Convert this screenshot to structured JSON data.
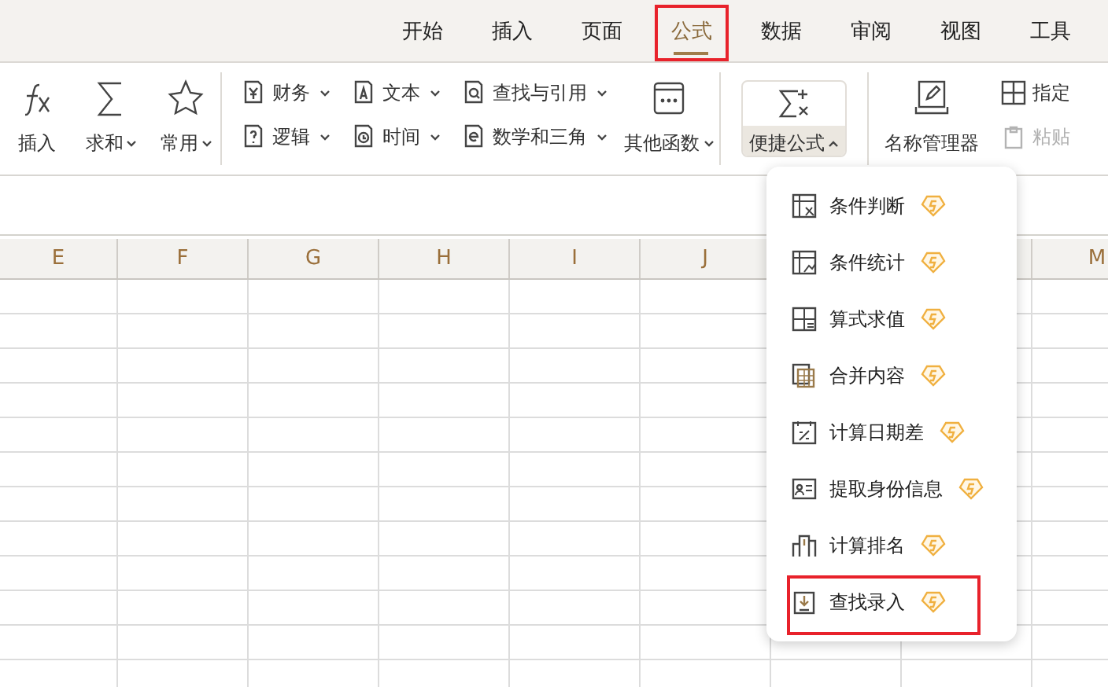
{
  "tabs": [
    {
      "label": "开始",
      "selected": false,
      "highlighted": false
    },
    {
      "label": "插入",
      "selected": false,
      "highlighted": false
    },
    {
      "label": "页面",
      "selected": false,
      "highlighted": false
    },
    {
      "label": "公式",
      "selected": true,
      "highlighted": true
    },
    {
      "label": "数据",
      "selected": false,
      "highlighted": false
    },
    {
      "label": "审阅",
      "selected": false,
      "highlighted": false
    },
    {
      "label": "视图",
      "selected": false,
      "highlighted": false
    },
    {
      "label": "工具",
      "selected": false,
      "highlighted": false
    }
  ],
  "ribbon": {
    "large_buttons": [
      {
        "label": "插入",
        "dropdown": false
      },
      {
        "label": "求和",
        "dropdown": true
      },
      {
        "label": "常用",
        "dropdown": true
      }
    ],
    "function_categories": [
      {
        "label": "财务"
      },
      {
        "label": "文本"
      },
      {
        "label": "查找与引用"
      },
      {
        "label": "逻辑"
      },
      {
        "label": "时间"
      },
      {
        "label": "数学和三角"
      }
    ],
    "other_functions": {
      "label": "其他函数"
    },
    "quick_formula": {
      "label": "便捷公式",
      "expanded": true
    },
    "name_manager": {
      "label": "名称管理器"
    },
    "small_buttons": [
      {
        "label": "指定",
        "disabled": false
      },
      {
        "label": "粘贴",
        "disabled": true
      }
    ]
  },
  "sheet": {
    "columns": [
      "E",
      "F",
      "G",
      "H",
      "I",
      "J",
      "M"
    ]
  },
  "menu": {
    "items": [
      {
        "label": "条件判断",
        "premium": true,
        "highlighted": false
      },
      {
        "label": "条件统计",
        "premium": true,
        "highlighted": false
      },
      {
        "label": "算式求值",
        "premium": true,
        "highlighted": false
      },
      {
        "label": "合并内容",
        "premium": true,
        "highlighted": false
      },
      {
        "label": "计算日期差",
        "premium": true,
        "highlighted": false
      },
      {
        "label": "提取身份信息",
        "premium": true,
        "highlighted": false
      },
      {
        "label": "计算排名",
        "premium": true,
        "highlighted": false
      },
      {
        "label": "查找录入",
        "premium": true,
        "highlighted": true
      }
    ]
  }
}
